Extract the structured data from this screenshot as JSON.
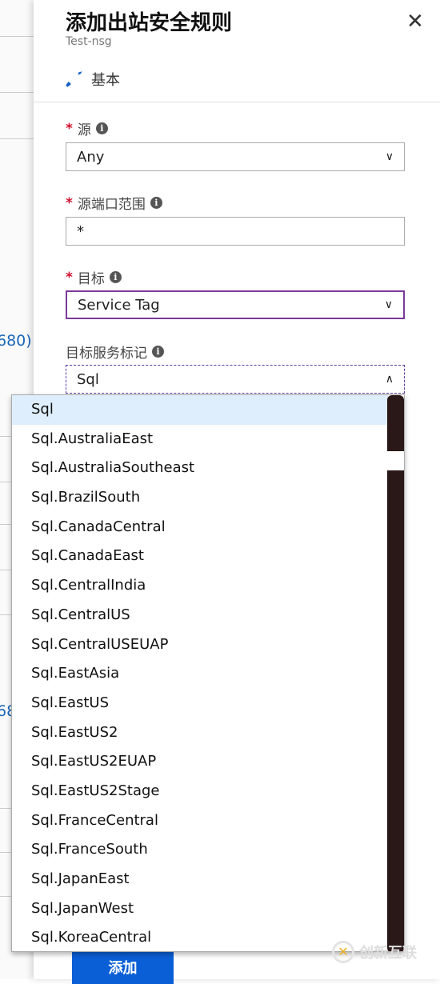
{
  "background": {
    "fragment_1": "680)",
    "fragment_2": "68"
  },
  "panel": {
    "title": "添加出站安全规则",
    "subtitle": "Test-nsg",
    "tab_label": "基本",
    "fields": [
      {
        "label": "源",
        "required": true,
        "value": "Any",
        "type": "select"
      },
      {
        "label": "源端口范围",
        "required": true,
        "value": "*",
        "type": "text"
      },
      {
        "label": "目标",
        "required": true,
        "value": "Service Tag",
        "type": "select"
      },
      {
        "label": "目标服务标记",
        "required": false,
        "value": "Sql",
        "type": "select-open"
      }
    ],
    "add_button": "添加"
  },
  "dropdown": {
    "selected": "Sql",
    "options": [
      "Sql",
      "Sql.AustraliaEast",
      "Sql.AustraliaSoutheast",
      "Sql.BrazilSouth",
      "Sql.CanadaCentral",
      "Sql.CanadaEast",
      "Sql.CentralIndia",
      "Sql.CentralUS",
      "Sql.CentralUSEUAP",
      "Sql.EastAsia",
      "Sql.EastUS",
      "Sql.EastUS2",
      "Sql.EastUS2EUAP",
      "Sql.EastUS2Stage",
      "Sql.FranceCentral",
      "Sql.FranceSouth",
      "Sql.JapanEast",
      "Sql.JapanWest",
      "Sql.KoreaCentral"
    ]
  },
  "watermark": "创新互联",
  "colors": {
    "accent": "#0a5fd6",
    "required": "#d01030",
    "focus_border": "#7a3a9a",
    "selected_option": "#deeefc"
  }
}
